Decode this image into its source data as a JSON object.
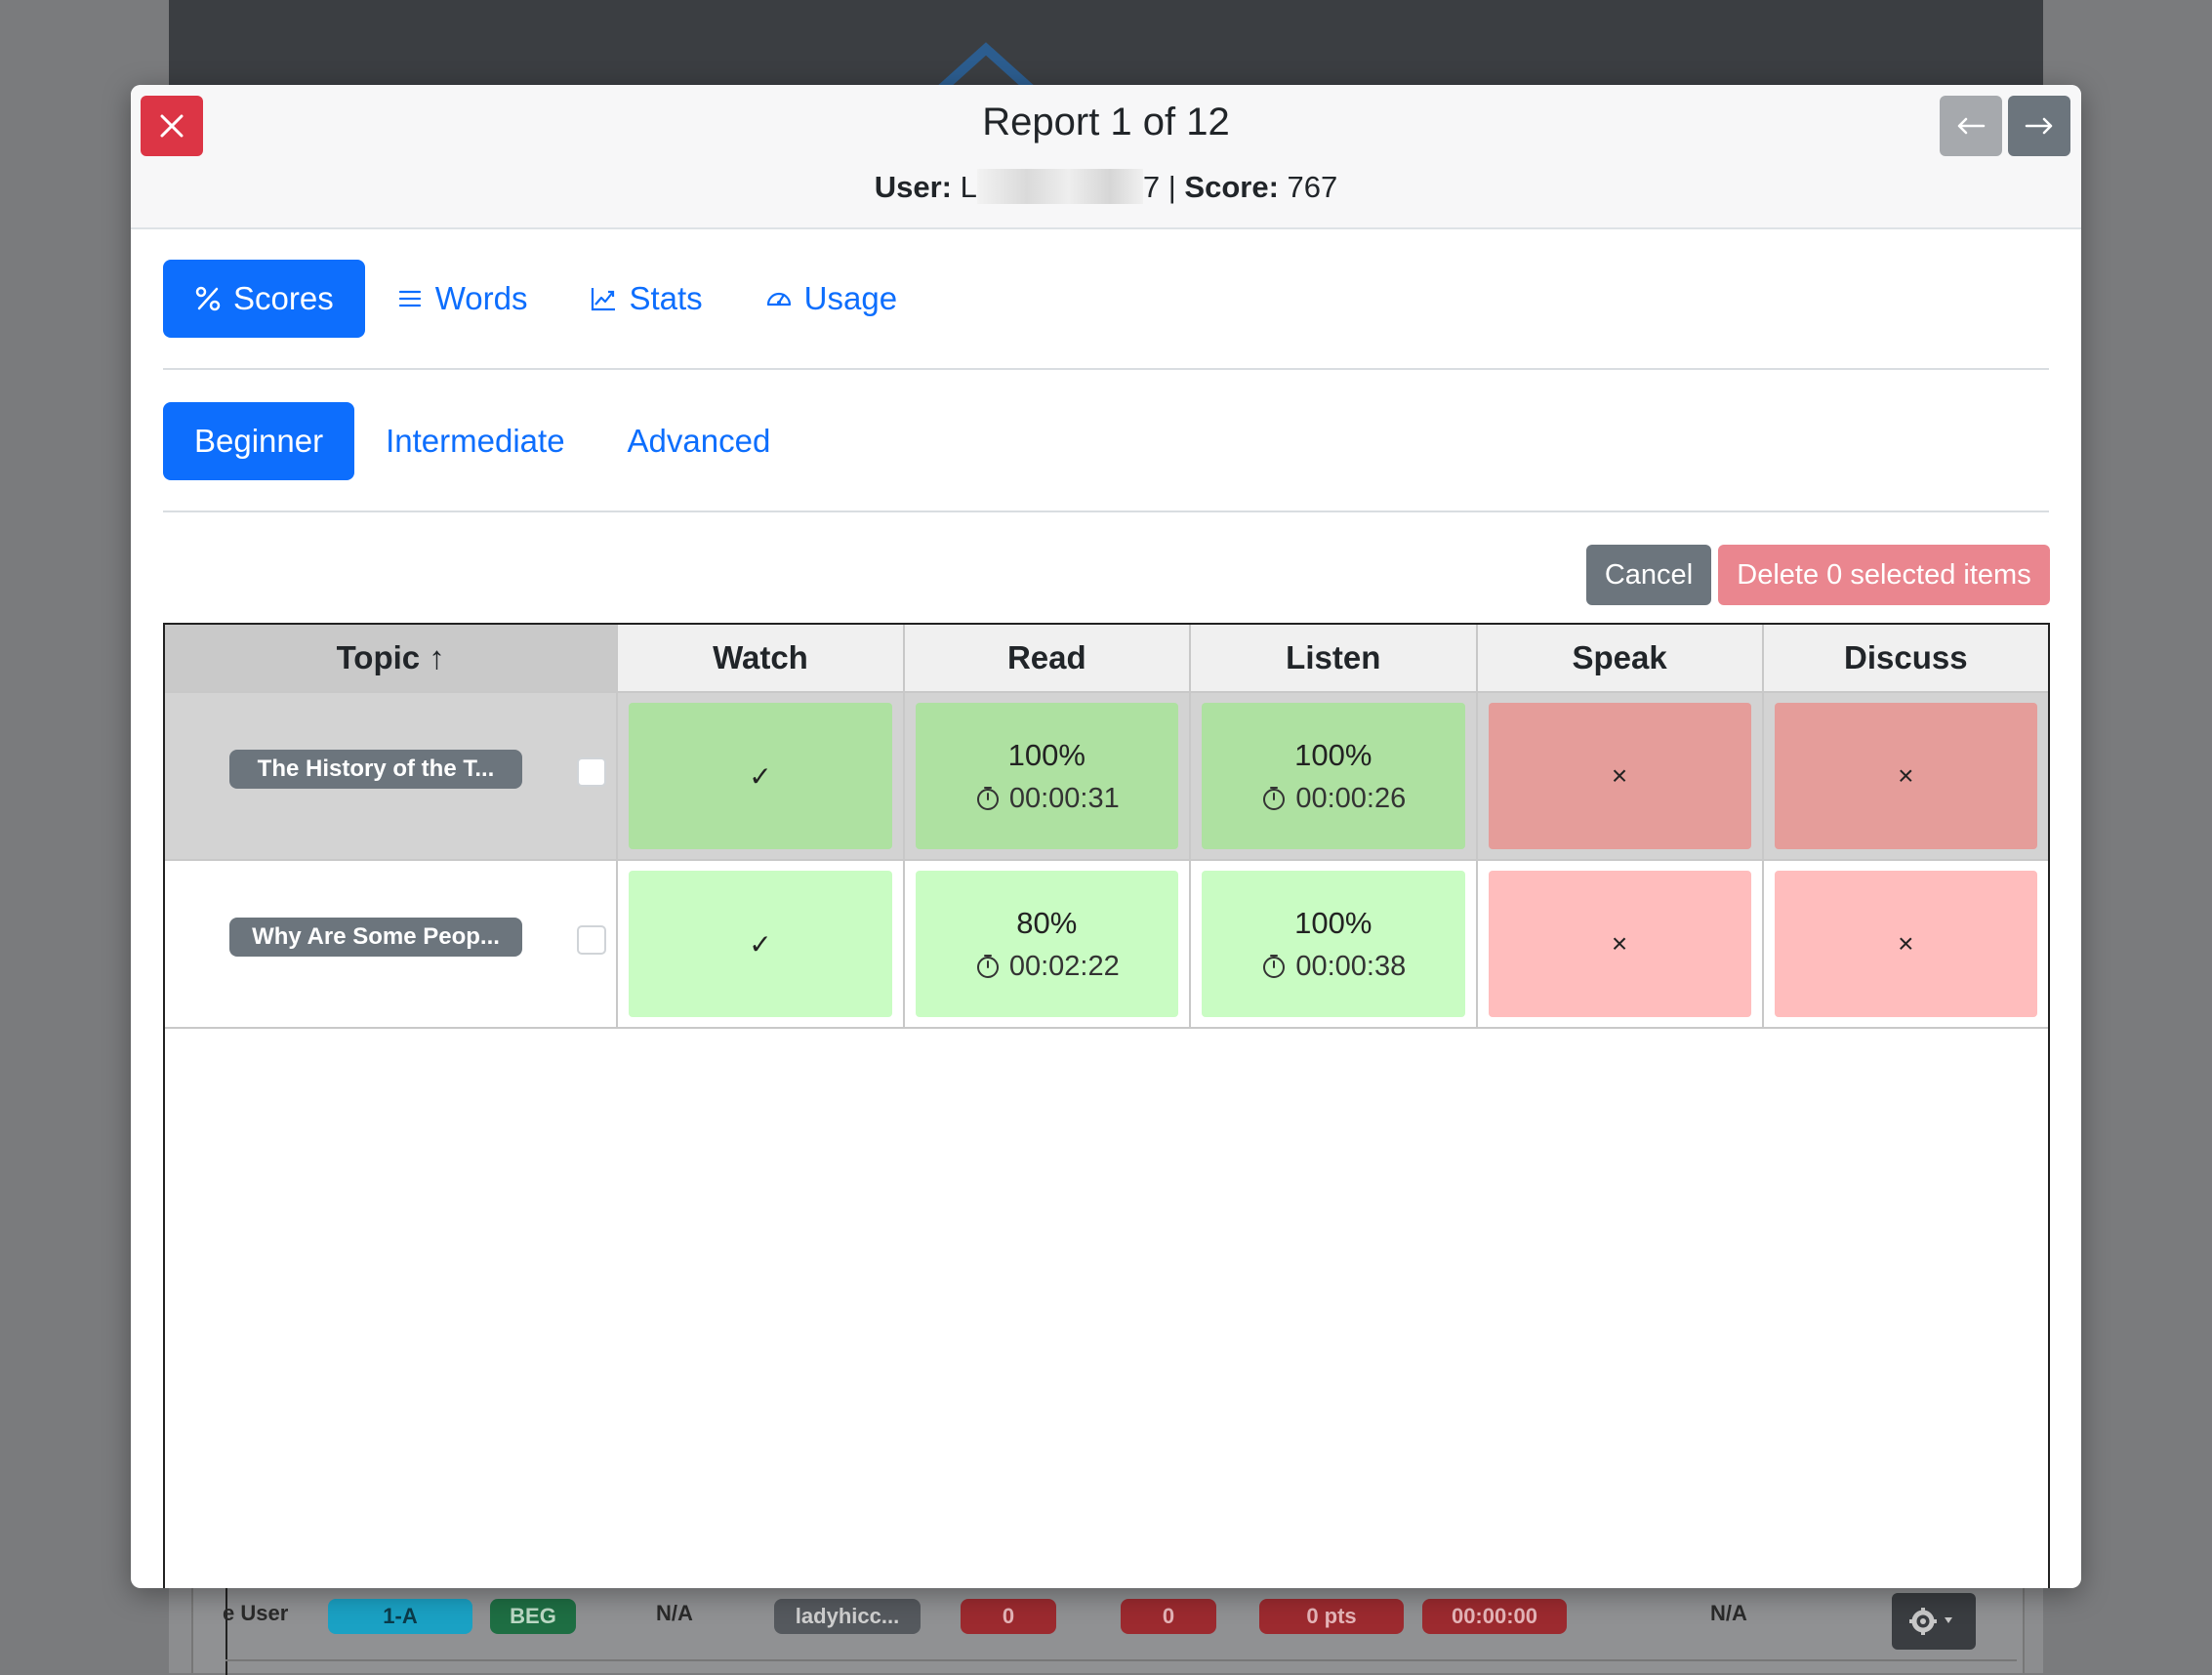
{
  "modal": {
    "title": "Report 1 of 12",
    "user_label": "User:",
    "user_value_start": "L",
    "user_value_end": "7",
    "separator": " | ",
    "score_label": "Score:",
    "score_value": "767"
  },
  "tabs": [
    {
      "label": "Scores",
      "icon": "percent-icon",
      "active": true
    },
    {
      "label": "Words",
      "icon": "list-icon",
      "active": false
    },
    {
      "label": "Stats",
      "icon": "chart-line-icon",
      "active": false
    },
    {
      "label": "Usage",
      "icon": "speedometer-icon",
      "active": false
    }
  ],
  "levels": [
    {
      "label": "Beginner",
      "active": true
    },
    {
      "label": "Intermediate",
      "active": false
    },
    {
      "label": "Advanced",
      "active": false
    }
  ],
  "actions": {
    "cancel": "Cancel",
    "delete": "Delete 0 selected items"
  },
  "table": {
    "headers": [
      "Topic ↑",
      "Watch",
      "Read",
      "Listen",
      "Speak",
      "Discuss"
    ],
    "rows": [
      {
        "topic": "The History of the T...",
        "watch": "✓",
        "read_pct": "100%",
        "read_time": "00:00:31",
        "listen_pct": "100%",
        "listen_time": "00:00:26",
        "speak": "×",
        "discuss": "×"
      },
      {
        "topic": "Why Are Some Peop...",
        "watch": "✓",
        "read_pct": "80%",
        "read_time": "00:02:22",
        "listen_pct": "100%",
        "listen_time": "00:00:38",
        "speak": "×",
        "discuss": "×"
      }
    ]
  },
  "background_row": {
    "user": "e User",
    "group": "1-A",
    "level": "BEG",
    "na1": "N/A",
    "username": "ladyhicc...",
    "count1": "0",
    "count2": "0",
    "points": "0 pts",
    "time": "00:00:00",
    "na2": "N/A"
  },
  "colors": {
    "primary": "#0d6efd",
    "danger": "#dc3545",
    "secondary": "#6c757d",
    "success_strong": "#aee1a1",
    "success_light": "#c9fcc3",
    "fail_strong": "#e59d9a",
    "fail_light": "#ffbdbd"
  }
}
